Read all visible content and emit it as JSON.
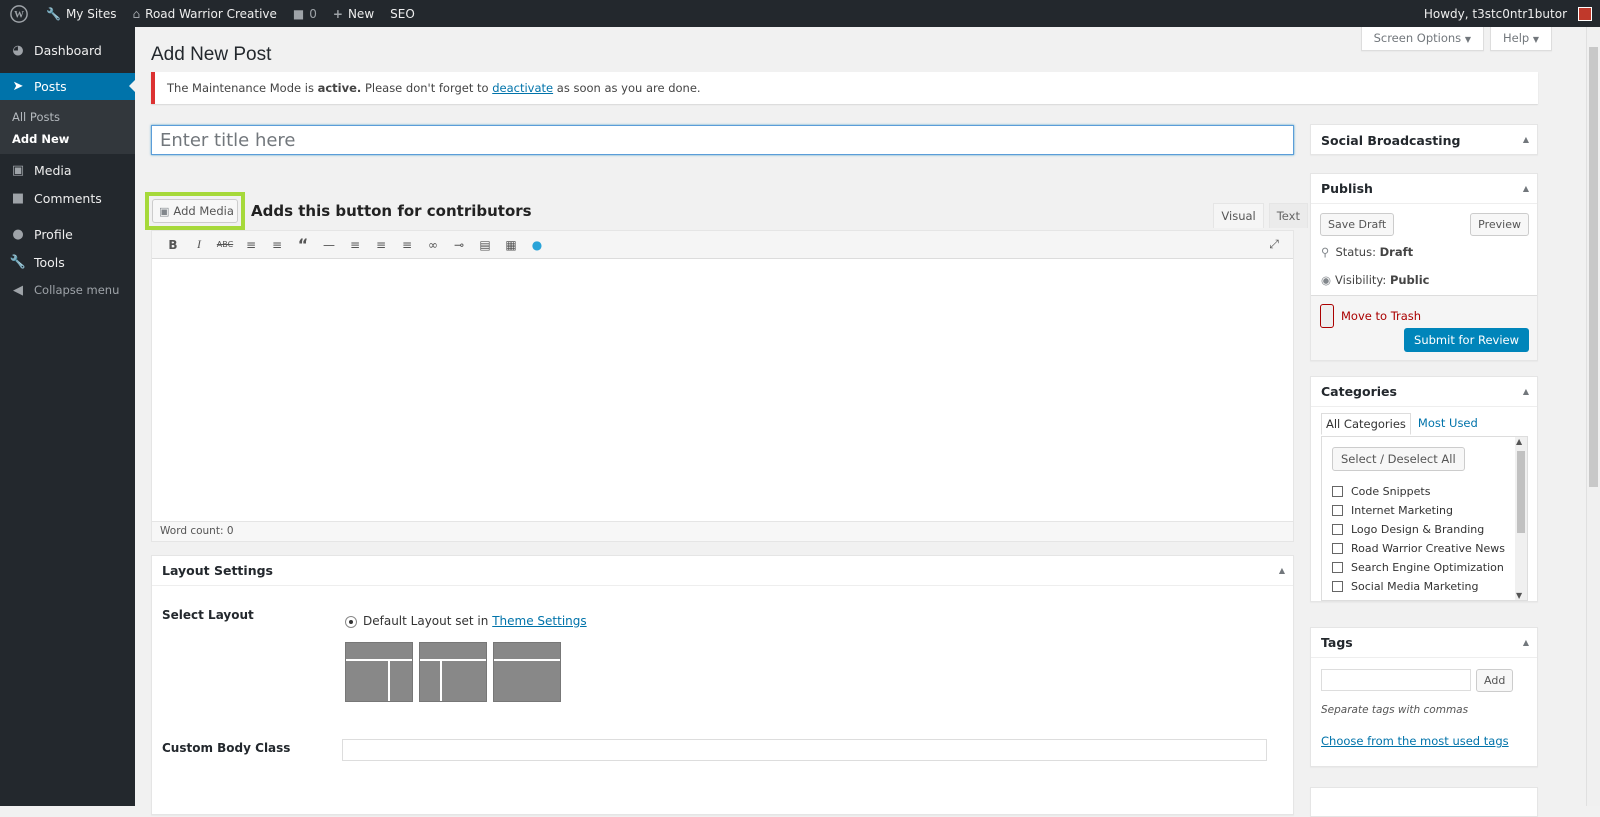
{
  "adminbar": {
    "my_sites": "My Sites",
    "site_name": "Road Warrior Creative",
    "comments_count": "0",
    "new_label": "New",
    "seo_label": "SEO",
    "howdy": "Howdy, t3stc0ntr1butor"
  },
  "sidebar": {
    "dashboard": "Dashboard",
    "posts": "Posts",
    "all_posts": "All Posts",
    "add_new": "Add New",
    "media": "Media",
    "comments": "Comments",
    "profile": "Profile",
    "tools": "Tools",
    "collapse": "Collapse menu"
  },
  "header": {
    "title": "Add New Post",
    "screen_options": "Screen Options",
    "help": "Help"
  },
  "notice": {
    "text1": "The Maintenance Mode is",
    "active": "active.",
    "text2": "Please don't forget to",
    "link": "deactivate",
    "text3": "as soon as you are done."
  },
  "title_input": {
    "placeholder": "Enter title here"
  },
  "editor": {
    "add_media": "Add Media",
    "annotation": "Adds this button for contributors",
    "tab_visual": "Visual",
    "tab_text": "Text",
    "word_count": "Word count: 0"
  },
  "layout": {
    "heading": "Layout Settings",
    "select_layout": "Select Layout",
    "default_text": "Default Layout set in",
    "theme_settings": "Theme Settings",
    "custom_body_class": "Custom Body Class"
  },
  "social": {
    "heading": "Social Broadcasting"
  },
  "publish": {
    "heading": "Publish",
    "save_draft": "Save Draft",
    "preview": "Preview",
    "status_label": "Status:",
    "status_value": "Draft",
    "visibility_label": "Visibility:",
    "visibility_value": "Public",
    "trash": "Move to Trash",
    "submit": "Submit for Review"
  },
  "categories": {
    "heading": "Categories",
    "tab_all": "All Categories",
    "tab_most": "Most Used",
    "select_all": "Select / Deselect All",
    "items": [
      "Code Snippets",
      "Internet Marketing",
      "Logo Design & Branding",
      "Road Warrior Creative News",
      "Search Engine Optimization",
      "Social Media Marketing"
    ]
  },
  "tags": {
    "heading": "Tags",
    "add": "Add",
    "hint": "Separate tags with commas",
    "choose": "Choose from the most used tags"
  }
}
